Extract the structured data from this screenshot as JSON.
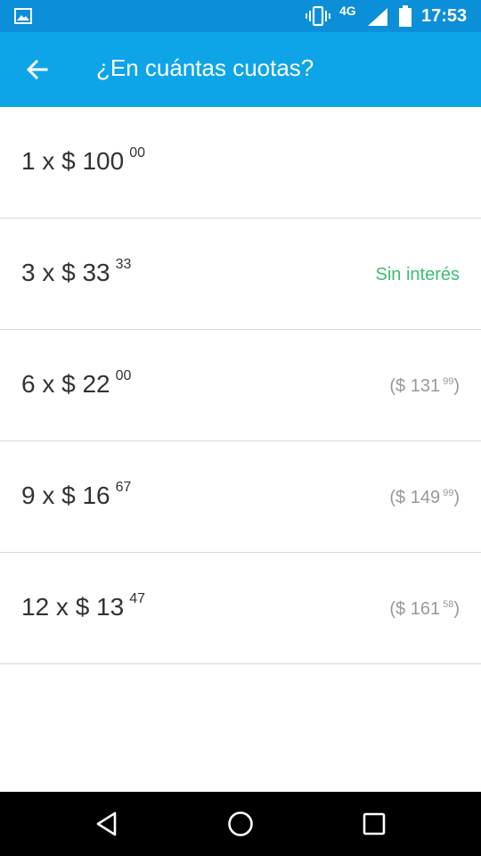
{
  "status_bar": {
    "network": "4G",
    "time": "17:53",
    "icons": [
      "gallery-icon",
      "vibrate-icon",
      "signal-icon",
      "battery-icon"
    ]
  },
  "app_bar": {
    "back_icon": "arrow-left-icon",
    "title": "¿En cuántas cuotas?"
  },
  "installments": [
    {
      "count_label": "1 x $ 100",
      "cents": "00",
      "side_amount": "",
      "side_cents": "",
      "side_suffix": "",
      "interest_free": ""
    },
    {
      "count_label": "3 x $ 33",
      "cents": "33",
      "side_amount": "",
      "side_cents": "",
      "side_suffix": "",
      "interest_free": "Sin interés"
    },
    {
      "count_label": "6 x $ 22",
      "cents": "00",
      "side_amount": "($ 131",
      "side_cents": "99",
      "side_suffix": ")",
      "interest_free": ""
    },
    {
      "count_label": "9 x $ 16",
      "cents": "67",
      "side_amount": "($ 149",
      "side_cents": "99",
      "side_suffix": ")",
      "interest_free": ""
    },
    {
      "count_label": "12 x $ 13",
      "cents": "47",
      "side_amount": "($ 161",
      "side_cents": "58",
      "side_suffix": ")",
      "interest_free": ""
    }
  ],
  "colors": {
    "status_bar": "#0a8fd8",
    "app_bar": "#0ea5e8",
    "interest_free": "#3bbd72",
    "total_text": "#999999",
    "main_text": "#333333"
  },
  "nav_bar": {
    "icons": [
      "back-triangle-icon",
      "home-circle-icon",
      "recents-square-icon"
    ]
  }
}
